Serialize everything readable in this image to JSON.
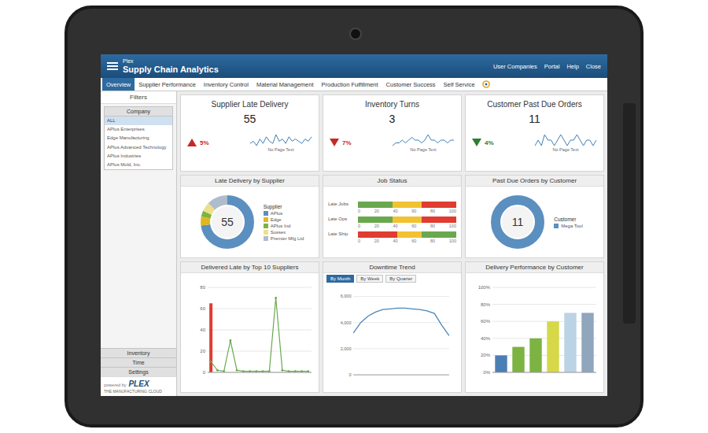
{
  "header": {
    "brand": "Plex",
    "title": "Supply Chain Analytics",
    "links": [
      "User Companies",
      "Portal",
      "Help",
      "Close"
    ]
  },
  "tabs": [
    {
      "label": "Overview",
      "selected": true
    },
    {
      "label": "Supplier Performance",
      "selected": false
    },
    {
      "label": "Inventory Control",
      "selected": false
    },
    {
      "label": "Material Management",
      "selected": false
    },
    {
      "label": "Production Fulfillment",
      "selected": false
    },
    {
      "label": "Customer Success",
      "selected": false
    },
    {
      "label": "Self Service",
      "selected": false
    }
  ],
  "sidebar": {
    "title": "Filters",
    "group": "Company",
    "items": [
      {
        "label": "ALL",
        "selected": true
      },
      {
        "label": "APlus Enterprises",
        "selected": false
      },
      {
        "label": "Edge Manufacturing",
        "selected": false
      },
      {
        "label": "APlus Advanced Technology",
        "selected": false
      },
      {
        "label": "APlus Industries",
        "selected": false
      },
      {
        "label": "APlus Mold, Inc.",
        "selected": false
      }
    ],
    "buttons": [
      "Inventory",
      "Time",
      "Settings"
    ]
  },
  "brand_footer": {
    "prefix": "powered by",
    "logo": "PLEX",
    "tagline": "THE MANUFACTURING CLOUD"
  },
  "kpis": [
    {
      "title": "Supplier Late Delivery",
      "value": "55",
      "trend": "up",
      "change": "5%",
      "color": "#c62828",
      "caption": "No Page Text",
      "spark": [
        5,
        6,
        4,
        7,
        5,
        8,
        6,
        5,
        9,
        6,
        7,
        5,
        8,
        6,
        7,
        6,
        5,
        7,
        6,
        8
      ]
    },
    {
      "title": "Inventory Turns",
      "value": "3",
      "trend": "down",
      "change": "7%",
      "color": "#c62828",
      "caption": "No Page Text",
      "spark": [
        4,
        5,
        5,
        6,
        5,
        6,
        7,
        6,
        6,
        5,
        6,
        8,
        6,
        6,
        5,
        6,
        6,
        5,
        6,
        6
      ]
    },
    {
      "title": "Customer Past Due Orders",
      "value": "11",
      "trend": "down",
      "change": "4%",
      "color": "#2e7d32",
      "caption": "No Page Text",
      "spark": [
        5,
        6,
        5,
        7,
        6,
        6,
        5,
        6,
        7,
        6,
        5,
        6,
        6,
        7,
        6,
        5,
        6,
        6,
        5,
        6
      ]
    }
  ],
  "late_by_supplier": {
    "title": "Late Delivery by Supplier",
    "total": "55",
    "legend_title": "Supplier",
    "segments": [
      {
        "label": "APlus",
        "value": 40,
        "color": "#5b8fbf"
      },
      {
        "label": "Edge",
        "value": 3,
        "color": "#e0b81e"
      },
      {
        "label": "APlus Ind",
        "value": 2,
        "color": "#7cb342"
      },
      {
        "label": "Sussex",
        "value": 3,
        "color": "#eee08a"
      },
      {
        "label": "Premier Mfg Ltd",
        "value": 7,
        "color": "#aebccb"
      }
    ]
  },
  "job_status": {
    "title": "Job Status",
    "ticks": [
      "0",
      "20",
      "40",
      "60",
      "80",
      "100"
    ],
    "rows": [
      {
        "label": "Late Jobs",
        "segments": [
          {
            "value": 35,
            "color": "#6aa84f"
          },
          {
            "value": 30,
            "color": "#f1c232"
          },
          {
            "value": 35,
            "color": "#e03c31"
          }
        ]
      },
      {
        "label": "Late Ops",
        "segments": [
          {
            "value": 35,
            "color": "#6aa84f"
          },
          {
            "value": 30,
            "color": "#f1c232"
          },
          {
            "value": 35,
            "color": "#e03c31"
          }
        ]
      },
      {
        "label": "Late Ship",
        "segments": [
          {
            "value": 40,
            "color": "#e03c31"
          },
          {
            "value": 25,
            "color": "#f1c232"
          },
          {
            "value": 35,
            "color": "#6aa84f"
          }
        ]
      }
    ]
  },
  "past_due_by_customer": {
    "title": "Past Due Orders by Customer",
    "total": "11",
    "legend_title": "Customer",
    "segments": [
      {
        "label": "Mega Tool",
        "value": 11,
        "color": "#5b8fbf"
      }
    ]
  },
  "delivered_late": {
    "title": "Delivered Late by Top 10 Suppliers",
    "ticks": [
      "0",
      "20",
      "40",
      "60",
      "80"
    ],
    "series": [
      {
        "kind": "bar",
        "color": "#e03c31",
        "values": [
          65,
          0,
          0,
          0,
          0,
          0,
          0,
          0,
          0,
          0,
          0,
          0,
          0,
          0,
          0,
          0
        ]
      },
      {
        "kind": "line",
        "color": "#6aa84f",
        "values": [
          10,
          2,
          1,
          30,
          2,
          1,
          1,
          1,
          1,
          1,
          70,
          2,
          1,
          1,
          1,
          1
        ]
      }
    ]
  },
  "downtime": {
    "title": "Downtime Trend",
    "toggles": [
      {
        "label": "By Month",
        "selected": true
      },
      {
        "label": "By Week",
        "selected": false
      },
      {
        "label": "By Quarter",
        "selected": false
      }
    ],
    "ticks": [
      "0",
      "2,000",
      "4,000",
      "6,000"
    ],
    "values": [
      3200,
      4000,
      4500,
      4800,
      5000,
      5050,
      5100,
      5100,
      5050,
      5000,
      4900,
      4700,
      3800,
      3000
    ]
  },
  "delivery_performance": {
    "title": "Delivery Performance by Customer",
    "ticks": [
      "0%",
      "20%",
      "40%",
      "60%",
      "80%",
      "100%"
    ],
    "bars": [
      {
        "value": 20,
        "color": "#4a7fb5"
      },
      {
        "value": 30,
        "color": "#7cb342"
      },
      {
        "value": 40,
        "color": "#7cb342"
      },
      {
        "value": 60,
        "color": "#d6d84a"
      },
      {
        "value": 70,
        "color": "#bcd3e6"
      },
      {
        "value": 70,
        "color": "#8fa6bd"
      }
    ]
  }
}
